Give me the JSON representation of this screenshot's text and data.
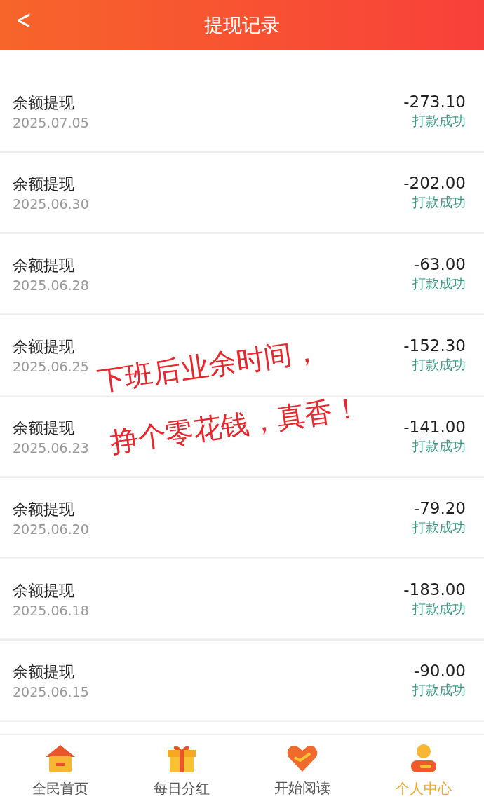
{
  "header": {
    "back": "<",
    "title": "提现记录"
  },
  "records": [
    {
      "title": "余额提现",
      "date": "2025.07.05",
      "amount": "-273.10",
      "status": "打款成功"
    },
    {
      "title": "余额提现",
      "date": "2025.06.30",
      "amount": "-202.00",
      "status": "打款成功"
    },
    {
      "title": "余额提现",
      "date": "2025.06.28",
      "amount": "-63.00",
      "status": "打款成功"
    },
    {
      "title": "余额提现",
      "date": "2025.06.25",
      "amount": "-152.30",
      "status": "打款成功"
    },
    {
      "title": "余额提现",
      "date": "2025.06.23",
      "amount": "-141.00",
      "status": "打款成功"
    },
    {
      "title": "余额提现",
      "date": "2025.06.20",
      "amount": "-79.20",
      "status": "打款成功"
    },
    {
      "title": "余额提现",
      "date": "2025.06.18",
      "amount": "-183.00",
      "status": "打款成功"
    },
    {
      "title": "余额提现",
      "date": "2025.06.15",
      "amount": "-90.00",
      "status": "打款成功"
    }
  ],
  "overlay_caption": [
    "下班后业余时间，",
    "挣个零花钱，真香！"
  ],
  "tab_bar": [
    {
      "kind": "home",
      "label": "全民首页",
      "selected": false
    },
    {
      "kind": "gift",
      "label": "每日分红",
      "selected": false
    },
    {
      "kind": "heart",
      "label": "开始阅读",
      "selected": false
    },
    {
      "kind": "person",
      "label": "个人中心",
      "selected": true
    }
  ]
}
